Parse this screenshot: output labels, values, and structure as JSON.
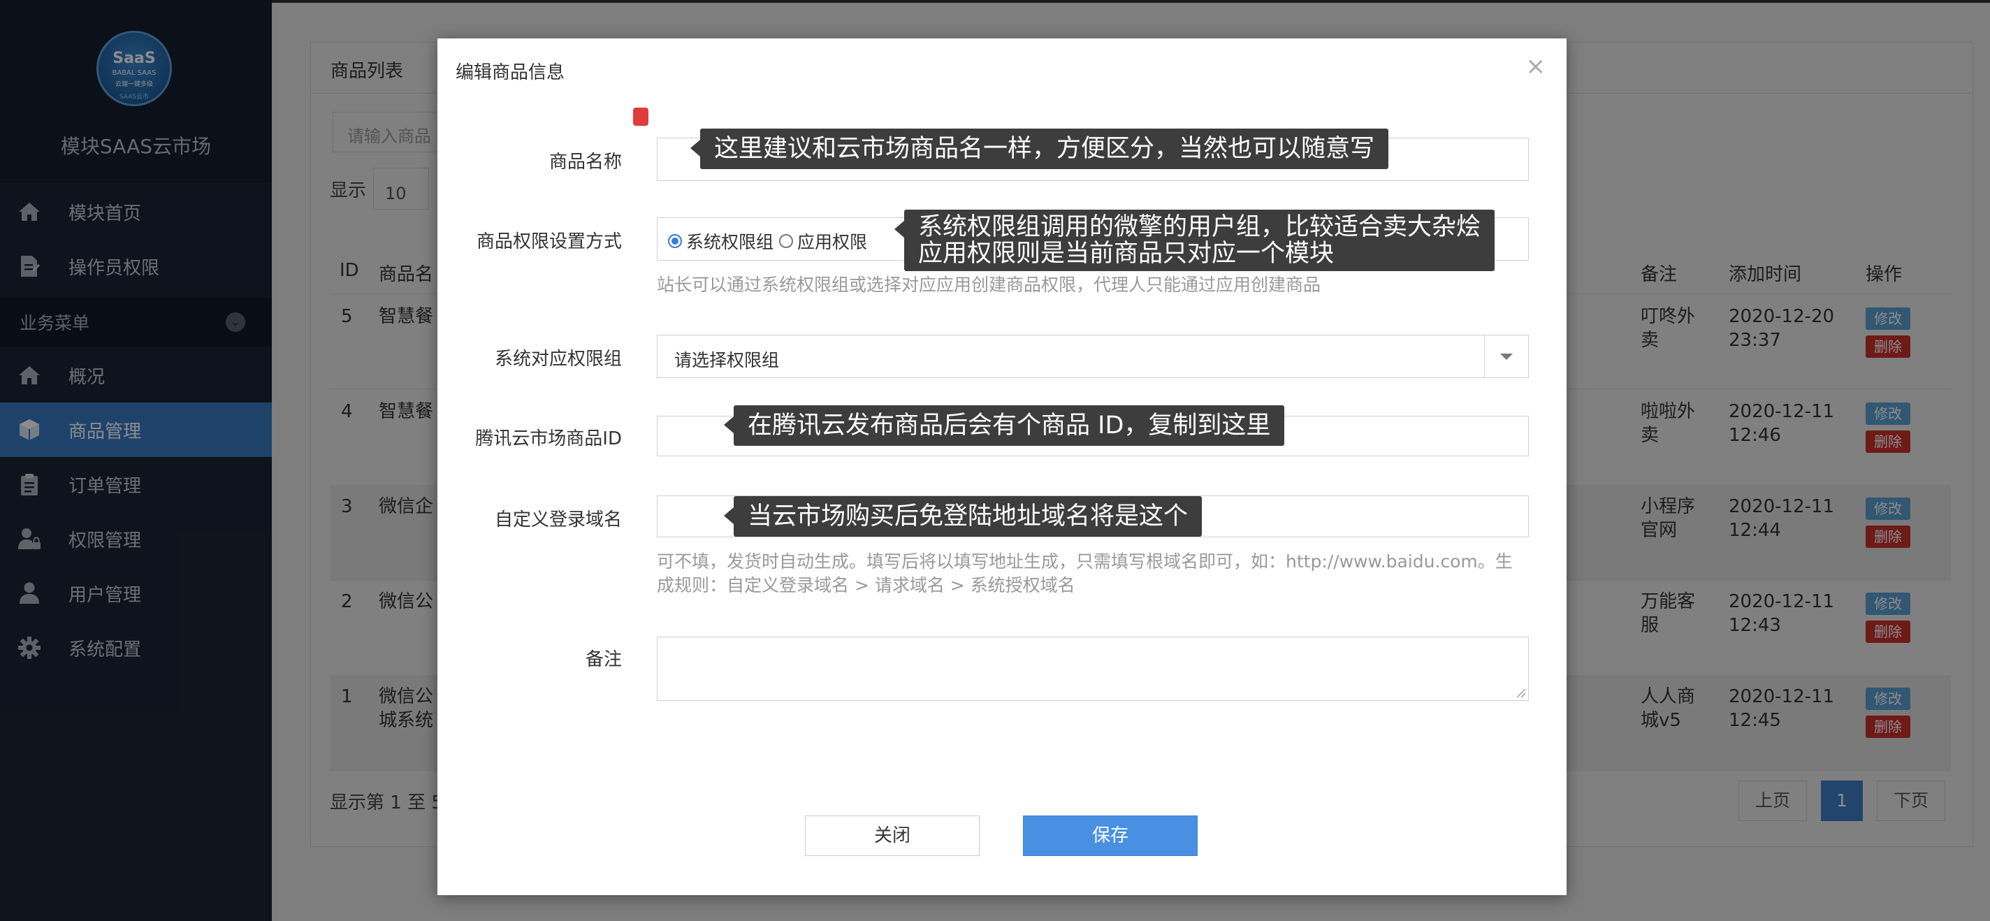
{
  "sidebar": {
    "logo": {
      "line1": "SaaS",
      "line2": "BABAL SAAS",
      "line3": "云端一键多级",
      "line4": "SAAS云市"
    },
    "app_title": "模块SAAS云市场",
    "items_top": [
      {
        "label": "模块首页",
        "icon": "home-icon"
      },
      {
        "label": "操作员权限",
        "icon": "file-edit-icon"
      }
    ],
    "group_label": "业务菜单",
    "items": [
      {
        "label": "概况",
        "icon": "home-icon"
      },
      {
        "label": "商品管理",
        "icon": "cube-icon",
        "active": true
      },
      {
        "label": "订单管理",
        "icon": "clipboard-icon"
      },
      {
        "label": "权限管理",
        "icon": "user-lock-icon"
      },
      {
        "label": "用户管理",
        "icon": "user-icon"
      },
      {
        "label": "系统配置",
        "icon": "gear-icon"
      }
    ]
  },
  "background": {
    "panel_title": "商品列表",
    "search_placeholder": "请输入商品",
    "show_label": "显示",
    "page_size": "10",
    "headers": {
      "id": "ID",
      "name": "商品名",
      "note": "备注",
      "time": "添加时间",
      "op": "操作"
    },
    "rows": [
      {
        "id": "5",
        "name": "智慧餐",
        "note": [
          "叮咚外",
          "卖"
        ],
        "time": [
          "2020-12-20",
          "23:37"
        ]
      },
      {
        "id": "4",
        "name": "智慧餐",
        "note": [
          "啦啦外",
          "卖"
        ],
        "time": [
          "2020-12-11",
          "12:46"
        ]
      },
      {
        "id": "3",
        "name": "微信企",
        "note": [
          "小程序",
          "官网"
        ],
        "time": [
          "2020-12-11",
          "12:44"
        ]
      },
      {
        "id": "2",
        "name": "微信公",
        "note": [
          "万能客",
          "服"
        ],
        "time": [
          "2020-12-11",
          "12:43"
        ]
      },
      {
        "id": "1",
        "name": "微信公",
        "name2": "城系统",
        "note": [
          "人人商",
          "城v5"
        ],
        "time": [
          "2020-12-11",
          "12:45"
        ]
      }
    ],
    "edit_label": "修改",
    "delete_label": "删除",
    "footer_info": "显示第 1 至 5",
    "pager": {
      "prev": "上页",
      "current": "1",
      "next": "下页"
    }
  },
  "modal": {
    "title": "编辑商品信息",
    "close_symbol": "×",
    "fields": {
      "name_label": "商品名称",
      "perm_mode_label": "商品权限设置方式",
      "radio_system": "系统权限组",
      "radio_app": "应用权限",
      "perm_help": "站长可以通过系统权限组或选择对应应用创建商品权限，代理人只能通过应用创建商品",
      "group_label": "系统对应权限组",
      "group_placeholder": "请选择权限组",
      "tencent_id_label": "腾讯云市场商品ID",
      "domain_label": "自定义登录域名",
      "domain_help_1": "可不填，发货时自动生成。填写后将以填写地址生成，只需填写根域名即可，如：http://www.baidu.com。生",
      "domain_help_2": "成规则：自定义登录域名 > 请求域名 > 系统授权域名",
      "note_label": "备注"
    },
    "buttons": {
      "close": "关闭",
      "save": "保存"
    }
  },
  "tooltips": {
    "name": "这里建议和云市场商品名一样，方便区分，当然也可以随意写",
    "perm_line1": "系统权限组调用的微擎的用户组，比较适合卖大杂烩",
    "perm_line2": "应用权限则是当前商品只对应一个模块",
    "tencent_id": "在腾讯云发布商品后会有个商品 ID，复制到这里",
    "domain": "当云市场购买后免登陆地址域名将是这个"
  }
}
